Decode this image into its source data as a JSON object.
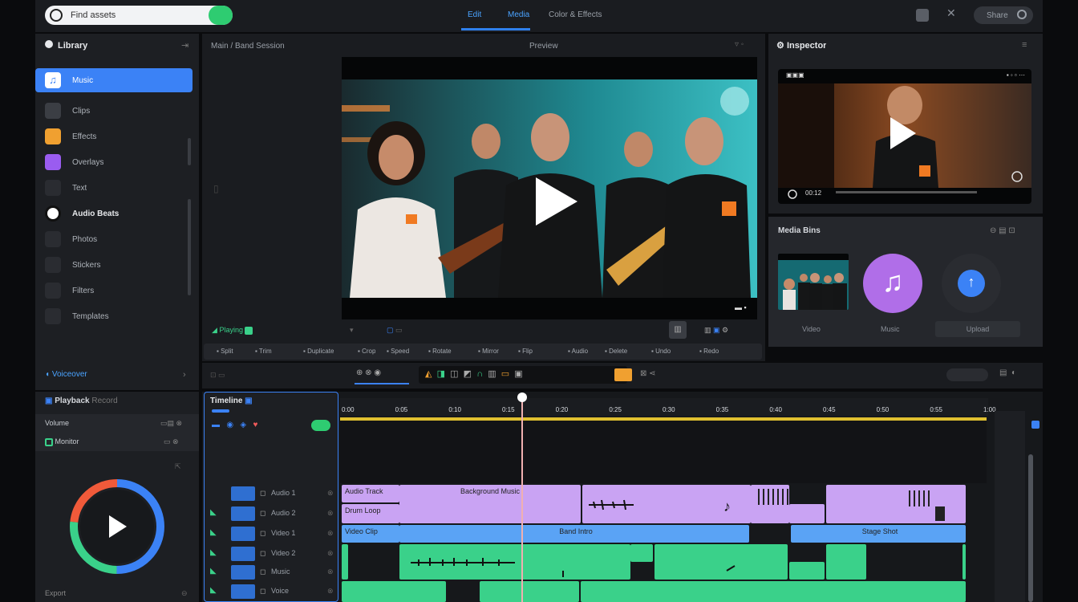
{
  "topbar": {
    "search_placeholder": "Find assets",
    "tabs": [
      "Edit",
      "Media",
      "Color & Effects"
    ],
    "user_label": "Share"
  },
  "sidebar": {
    "title": "Library",
    "items": [
      {
        "label": "Music",
        "icon": "music-note-icon",
        "selected": true
      },
      {
        "label": "Clips",
        "icon": "clip-icon"
      },
      {
        "label": "Effects",
        "icon": "effects-icon"
      },
      {
        "label": "Overlays",
        "icon": "overlay-icon"
      },
      {
        "label": "Text",
        "icon": "text-icon"
      },
      {
        "label": "Audio Beats",
        "icon": "audio-icon"
      },
      {
        "label": "Photos",
        "icon": "photo-icon"
      },
      {
        "label": "Stickers",
        "icon": "sticker-icon"
      },
      {
        "label": "Filters",
        "icon": "filter-icon"
      },
      {
        "label": "Templates",
        "icon": "template-icon"
      }
    ],
    "footer_label": "Voiceover"
  },
  "viewer": {
    "title": "Main / Band Session",
    "tab": "Preview",
    "status": "Playing",
    "toolbar": [
      "Split",
      "Trim",
      "Duplicate",
      "Crop",
      "Speed",
      "Rotate",
      "Mirror",
      "Flip",
      "Audio",
      "Delete",
      "Undo",
      "Redo"
    ]
  },
  "rpanel": {
    "title": "Inspector",
    "preview_time": "00:12",
    "media_title": "Media Bins",
    "media": [
      {
        "label": "Video"
      },
      {
        "label": "Music"
      },
      {
        "label": "Upload"
      }
    ]
  },
  "timeline": {
    "title": "Timeline",
    "ticks": [
      "0:00",
      "0:05",
      "0:10",
      "0:15",
      "0:20",
      "0:25",
      "0:30",
      "0:35",
      "0:40",
      "0:45",
      "0:50",
      "0:55",
      "1:00"
    ],
    "tracks": [
      {
        "label": "Audio 1"
      },
      {
        "label": "Audio 2"
      },
      {
        "label": "Video 1"
      },
      {
        "label": "Video 2"
      },
      {
        "label": "Music"
      },
      {
        "label": "Voice"
      }
    ],
    "clips": {
      "a1": "Audio Track",
      "a1b": "Background Music",
      "a2": "Drum Loop",
      "v1": "Video Clip",
      "v1b": "Band Intro",
      "v1c": "Stage Shot"
    }
  },
  "leftbottom": {
    "title": "Playback",
    "subtitle": "Record",
    "row1": "Volume",
    "row2": "Monitor",
    "footer": "Export"
  },
  "colors": {
    "accent": "#3b82f6",
    "green": "#2ecc71",
    "purple": "#c79bf0",
    "blue": "#5aa3f5",
    "teal": "#3ad18a"
  }
}
